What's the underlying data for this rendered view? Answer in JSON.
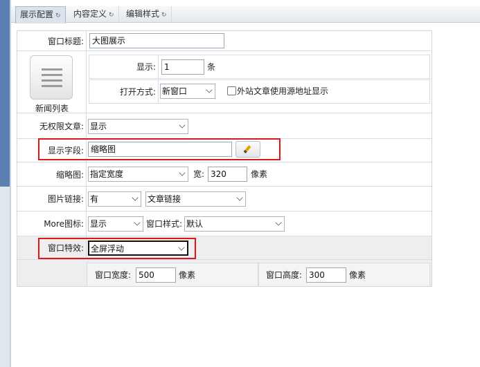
{
  "tabs": [
    {
      "label": "展示配置",
      "active": true
    },
    {
      "label": "内容定义",
      "active": false
    },
    {
      "label": "编辑样式",
      "active": false
    }
  ],
  "reload_glyph": "↻",
  "form": {
    "window_title": {
      "label": "窗口标题:",
      "value": "大图展示"
    },
    "list_widget": {
      "caption": "新闻列表",
      "show": {
        "label": "显示:",
        "value": "1",
        "unit": "条"
      },
      "open_mode": {
        "label": "打开方式:",
        "value": "新窗口"
      },
      "external_link": {
        "label": "外站文章使用源地址显示",
        "checked": false
      }
    },
    "no_permission": {
      "label": "无权限文章:",
      "value": "显示"
    },
    "display_field": {
      "label": "显示字段:",
      "value": "缩略图"
    },
    "thumbnail": {
      "label": "缩略图:",
      "mode": "指定宽度",
      "width_label": "宽:",
      "width_value": "320",
      "unit": "像素"
    },
    "image_link": {
      "label": "图片链接:",
      "value": "有",
      "target": "文章链接"
    },
    "more_icon": {
      "label": "More图标:",
      "value": "显示",
      "style_label": "窗口样式:",
      "style_value": "默认"
    },
    "window_effect": {
      "label": "窗口特效:",
      "value": "全屏浮动"
    },
    "window_size": {
      "width_label": "窗口宽度:",
      "width_value": "500",
      "width_unit": "像素",
      "height_label": "窗口高度:",
      "height_value": "300",
      "height_unit": "像素"
    }
  },
  "colors": {
    "highlight": "#e0141c",
    "tab_active": "#dbe3ec"
  }
}
